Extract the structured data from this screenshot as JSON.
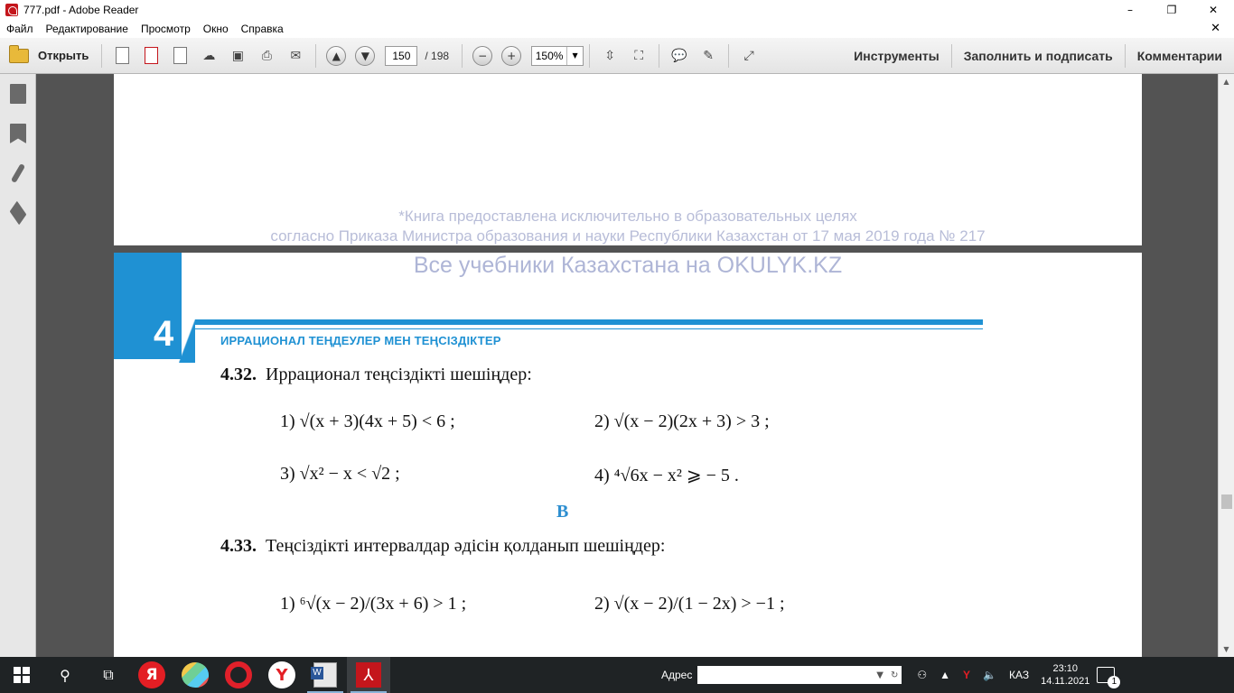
{
  "window": {
    "title": "777.pdf - Adobe Reader",
    "controls": [
      "–",
      "❐",
      "✕"
    ]
  },
  "menu": {
    "items": [
      "Файл",
      "Редактирование",
      "Просмотр",
      "Окно",
      "Справка"
    ],
    "close": "✕"
  },
  "toolbar": {
    "open_label": "Открыть",
    "page_current": "150",
    "page_total": "/ 198",
    "zoom": "150%",
    "tools_label": "Инструменты",
    "fill_sign_label": "Заполнить и подписать",
    "comments_label": "Комментарии"
  },
  "document": {
    "watermark_line1": "*Книга предоставлена исключительно в образовательных целях",
    "watermark_line2": "согласно Приказа Министра образования и науки Республики Казахстан от 17 мая 2019 года № 217",
    "watermark_line3": "Все учебники Казахстана на OKULYK.KZ",
    "chapter_number": "4",
    "chapter_title": "ИРРАЦИОНАЛ ТЕҢДЕУЛЕР МЕН ТЕҢСІЗДІКТЕР",
    "problem_432_num": "4.32.",
    "problem_432_text": "Иррационал теңсіздікті шешіңдер:",
    "p432_1": "1)  √(x + 3)(4x + 5) < 6 ;",
    "p432_2": "2)  √(x − 2)(2x + 3) > 3 ;",
    "p432_3": "3)  √x² − x < √2 ;",
    "p432_4": "4)  ⁴√6x − x² ⩾ − 5 .",
    "section_letter": "В",
    "problem_433_num": "4.33.",
    "problem_433_text": "Теңсіздікті интервалдар әдісін қолданып шешіңдер:",
    "p433_1": "1)  ⁶√(x − 2)/(3x + 6) > 1 ;",
    "p433_2": "2)  √(x − 2)/(1 − 2x) > −1 ;"
  },
  "taskbar": {
    "address_label": "Адрес",
    "lang": "КАЗ",
    "time": "23:10",
    "date": "14.11.2021",
    "notifications": "1",
    "yandex_letter": "Я"
  },
  "colors": {
    "accent_blue": "#1f91d3",
    "watermark": "#b8bdd8",
    "adobe_red": "#c4161c"
  }
}
